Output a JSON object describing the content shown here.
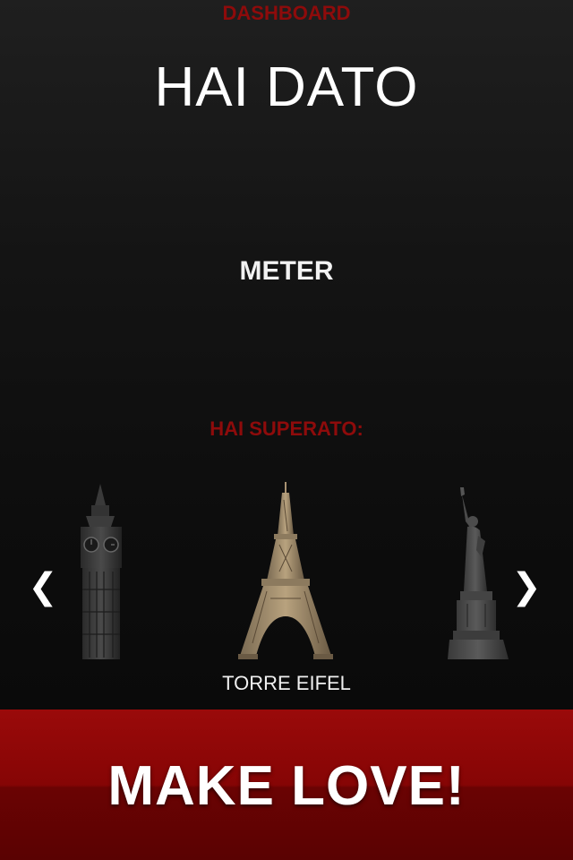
{
  "header": {
    "section_title": "DASHBOARD",
    "headline": "HAI DATO"
  },
  "meter": {
    "unit_label": "METER"
  },
  "achievements": {
    "title": "HAI SUPERATO:",
    "prev_arrow": "❮",
    "next_arrow": "❯",
    "monuments": [
      {
        "icon": "big-ben-icon"
      },
      {
        "icon": "eiffel-tower-icon",
        "name": "TORRE EIFEL",
        "selected": true
      },
      {
        "icon": "statue-of-liberty-icon"
      }
    ],
    "selected_name": "TORRE EIFEL"
  },
  "cta": {
    "label": "MAKE LOVE!"
  },
  "colors": {
    "accent_red": "#8e0b0b",
    "button_red": "#860505",
    "background": "#111111"
  }
}
